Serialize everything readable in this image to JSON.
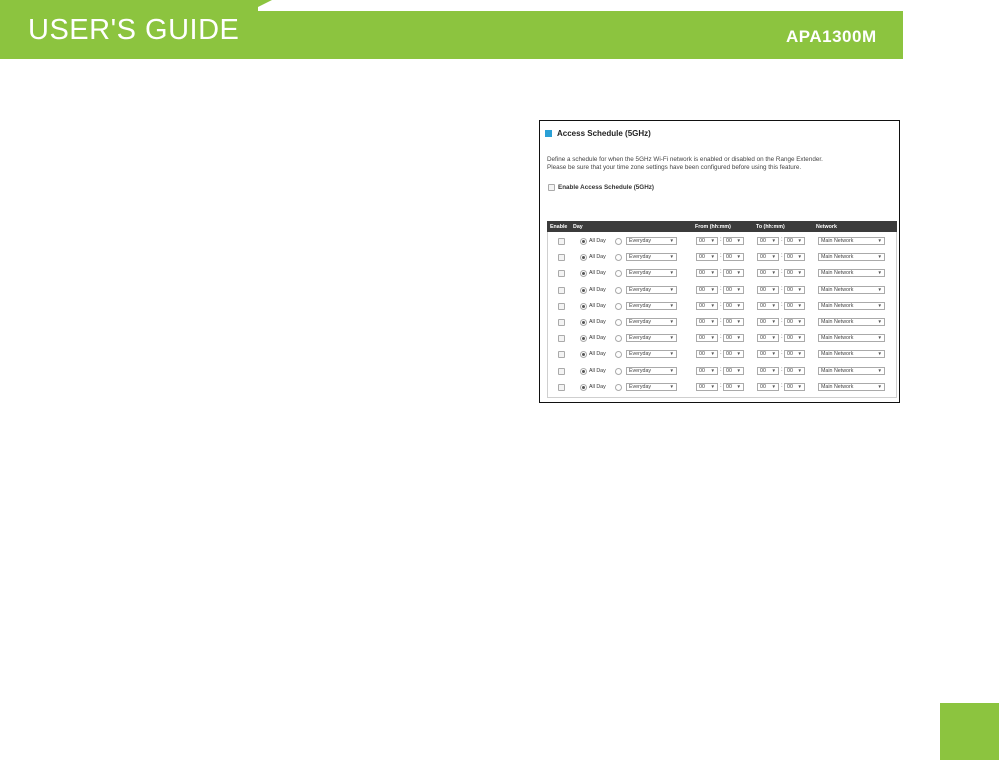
{
  "header": {
    "title": "USER'S GUIDE",
    "model": "APA1300M",
    "brand_color": "#8cc43f"
  },
  "panel": {
    "heading": "Access Schedule (5GHz)",
    "marker_color": "#2aa0d6",
    "description_line1": "Define a schedule for when the 5GHz Wi-Fi network is enabled or disabled on the Range Extender.",
    "description_line2": "Please be sure that your time zone settings have been configured before using this feature.",
    "enable_label": "Enable Access Schedule (5GHz)",
    "table": {
      "headers": {
        "enable": "Enable",
        "day": "Day",
        "from": "From (hh:mm)",
        "to": "To (hh:mm)",
        "network": "Network"
      },
      "row_values": {
        "all_day_label": "All Day",
        "day_select": "Everyday",
        "from_hour": "00",
        "from_minute": "00",
        "to_hour": "00",
        "to_minute": "00",
        "network": "Main Network",
        "colon": ":",
        "arrow": "▼"
      },
      "row_count": 10
    }
  }
}
